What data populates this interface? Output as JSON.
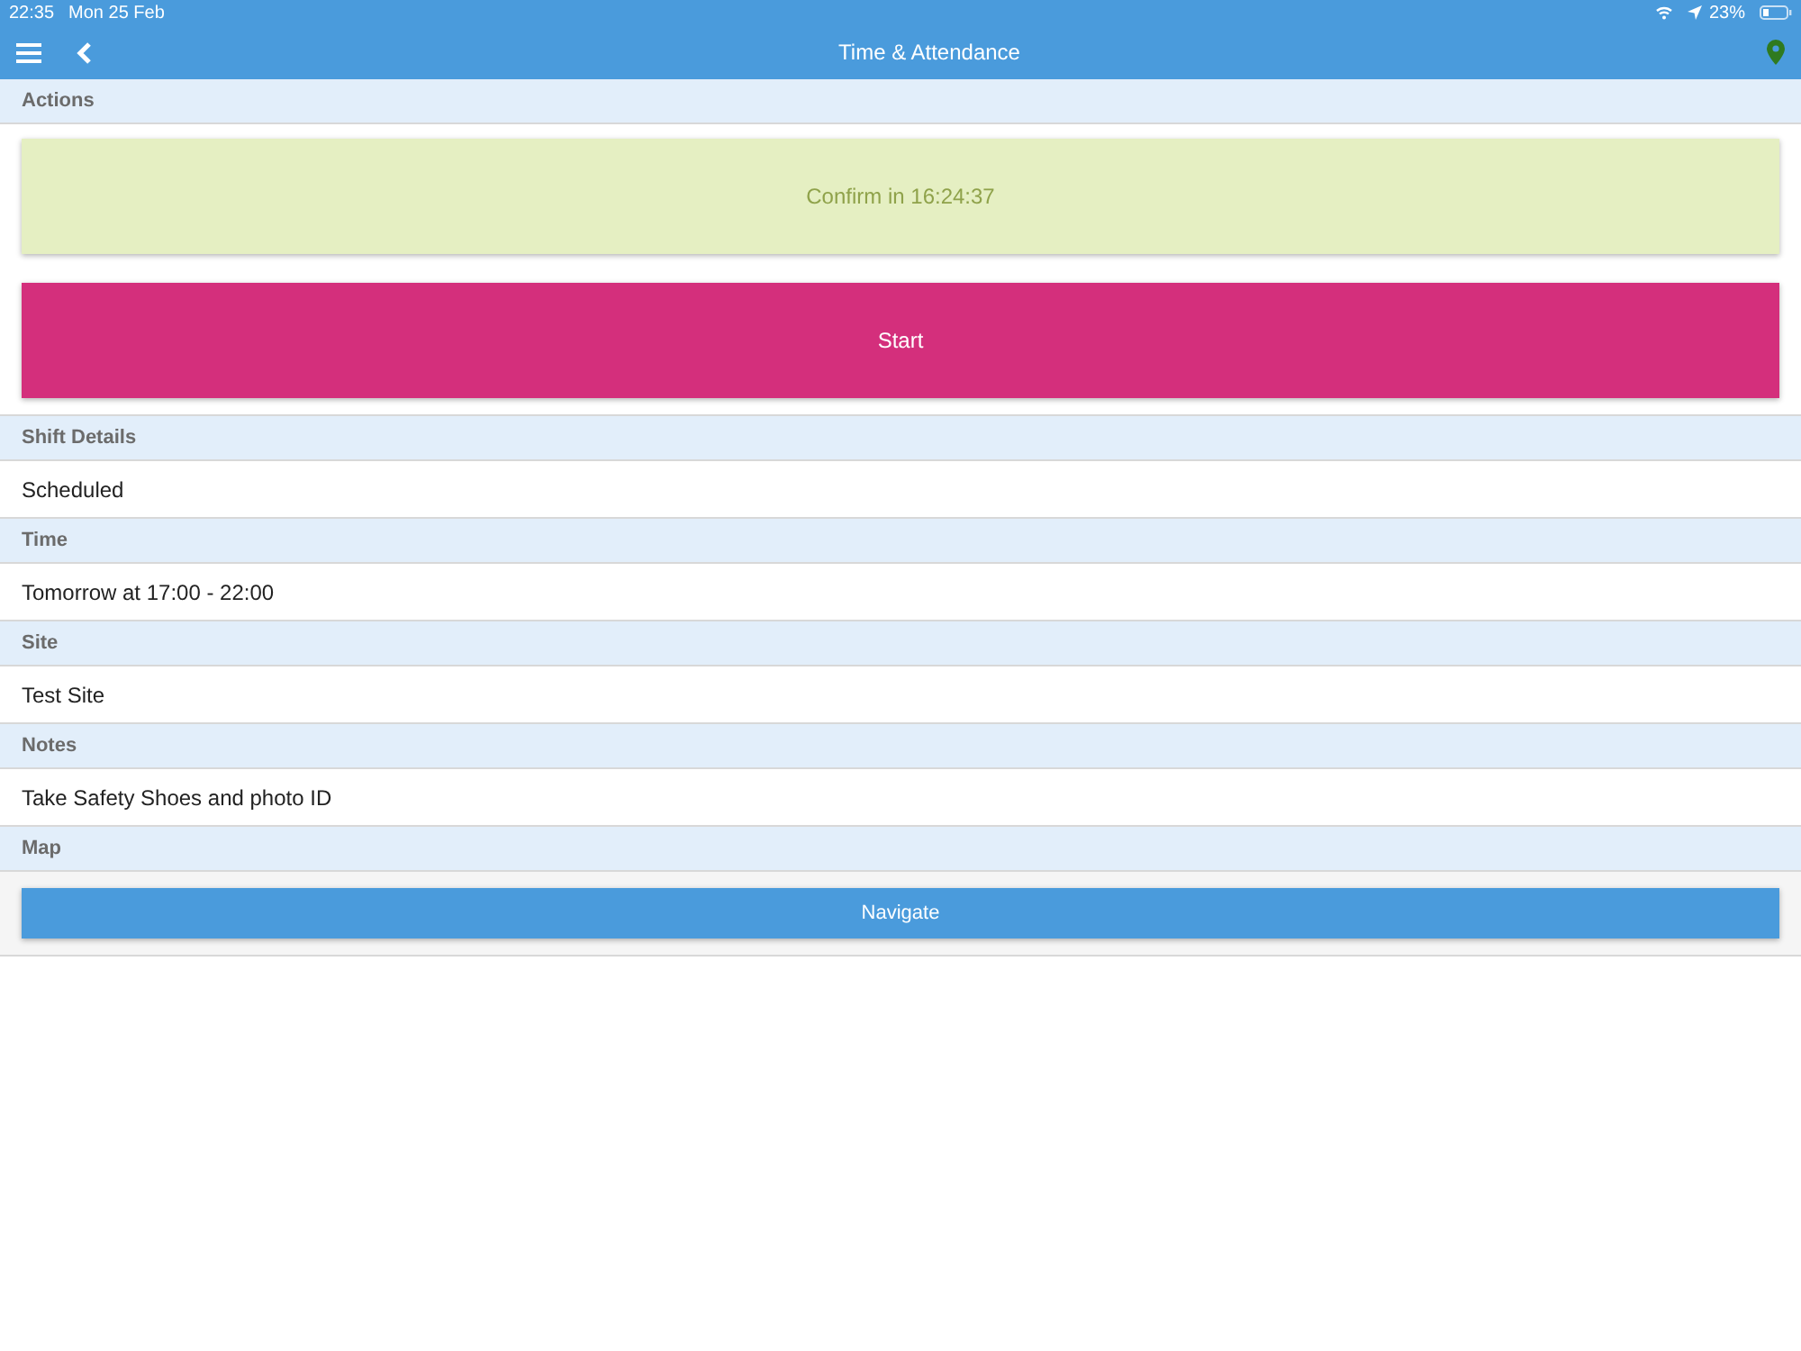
{
  "status_bar": {
    "time": "22:35",
    "date": "Mon 25 Feb",
    "battery": "23%"
  },
  "nav_bar": {
    "title": "Time & Attendance"
  },
  "actions": {
    "header": "Actions",
    "buttons": [
      {
        "label": "Confirm in 16:24:37",
        "kind": "confirm",
        "disabled": true
      },
      {
        "label": "Start",
        "kind": "start",
        "disabled": false
      }
    ]
  },
  "sections": [
    {
      "header": "Shift Details",
      "value": "Scheduled"
    },
    {
      "header": "Time",
      "value": "Tomorrow at 17:00 - 22:00"
    },
    {
      "header": "Site",
      "value": "Test Site"
    },
    {
      "header": "Notes",
      "value": "Take Safety Shoes and photo ID"
    }
  ],
  "map": {
    "header": "Map",
    "button": "Navigate"
  }
}
